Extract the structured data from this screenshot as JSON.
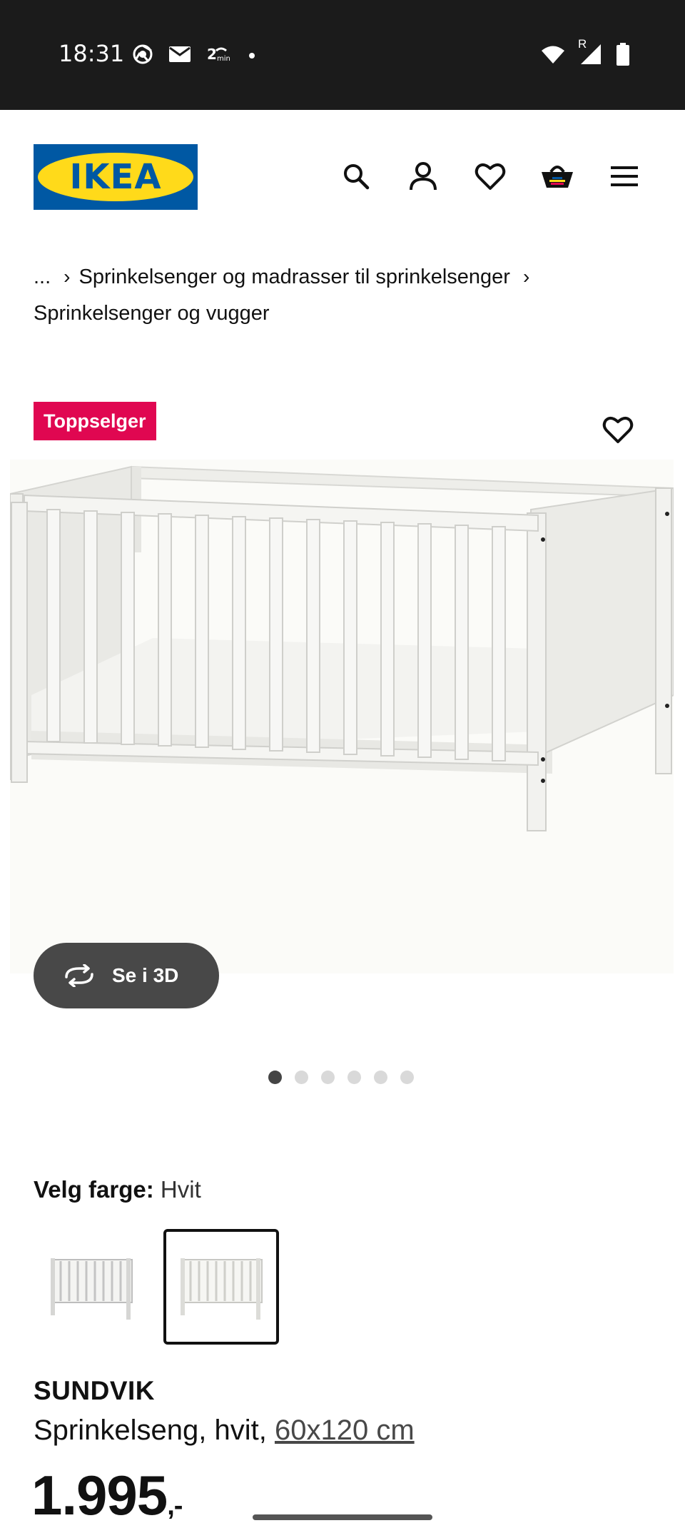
{
  "status_bar": {
    "time": "18:31",
    "left_icons": [
      "chrome-icon",
      "mail-icon",
      "20min-icon",
      "dot-icon"
    ],
    "right_icons": [
      "wifi-icon",
      "signal-icon",
      "battery-icon"
    ],
    "signal_label": "R"
  },
  "header": {
    "logo_text": "IKEA",
    "icons": [
      "search-icon",
      "account-icon",
      "favourites-icon",
      "basket-icon",
      "menu-icon"
    ]
  },
  "breadcrumb": {
    "items": [
      "...",
      "Sprinkelsenger og madrasser til sprinkelsenger",
      "Sprinkelsenger og vugger"
    ]
  },
  "gallery": {
    "badge": "Toppselger",
    "view_3d_label": "Se i 3D",
    "dot_count": 6,
    "active_index": 0
  },
  "color_select": {
    "label": "Velg farge:",
    "value": "Hvit"
  },
  "product": {
    "name": "SUNDVIK",
    "description": "Sprinkelseng, hvit,",
    "size": "60x120 cm",
    "price": "1.995",
    "price_suffix": ",-"
  },
  "colors": {
    "ikea_blue": "#0058a3",
    "ikea_yellow": "#ffda1a",
    "badge_red": "#e00751",
    "button_dark": "#484848"
  }
}
